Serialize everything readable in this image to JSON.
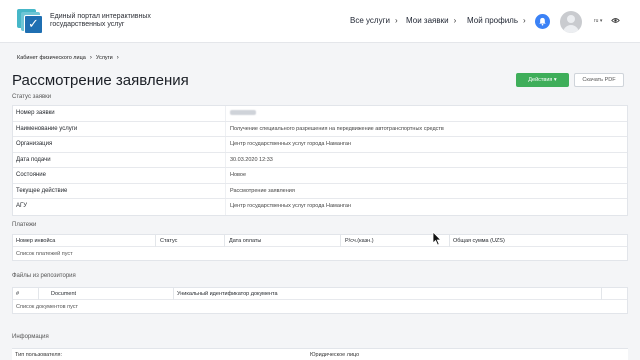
{
  "header": {
    "brand": "Единый портал интерактивных государственных услуг",
    "nav": [
      "Все услуги",
      "Мои заявки",
      "Мой профиль"
    ],
    "lang": "ru",
    "colors": {
      "accent": "#3b82f6",
      "primary_button": "#3fae5a"
    }
  },
  "breadcrumb": [
    "Кабинет физического лица",
    "Услуги"
  ],
  "page": {
    "title": "Рассмотрение заявления",
    "actions_label": "Действия ▾",
    "pdf_label": "Скачать PDF"
  },
  "status": {
    "section_label": "Статус заявки",
    "rows": [
      {
        "key": "Номер заявки",
        "value": ""
      },
      {
        "key": "Наименование услуги",
        "value": "Получение специального разрешения на передвижение автотранспортных средств"
      },
      {
        "key": "Организация",
        "value": "Центр государственных услуг города Наманган"
      },
      {
        "key": "Дата подачи",
        "value": "30.03.2020 12:33"
      },
      {
        "key": "Состояние",
        "value": "Новое"
      },
      {
        "key": "Текущее действие",
        "value": "Рассмотрение заявления"
      },
      {
        "key": "АГУ",
        "value": "Центр государственных услуг города Наманган"
      }
    ]
  },
  "payments": {
    "section_label": "Платежи",
    "columns": [
      "Номер инвойса",
      "Статус",
      "Дата оплаты",
      "Р/сч.(казн.)",
      "Общая сумма (UZS)"
    ],
    "empty_text": "Список платежей пуст"
  },
  "files": {
    "section_label": "Файлы из репозитория",
    "columns": [
      "#",
      "Document",
      "Уникальный идентификатор документа"
    ],
    "empty_text": "Список документов пуст"
  },
  "info": {
    "section_label": "Информация",
    "user_type_label": "Тип пользователя:",
    "user_type_value": "Юридическое лицо"
  }
}
